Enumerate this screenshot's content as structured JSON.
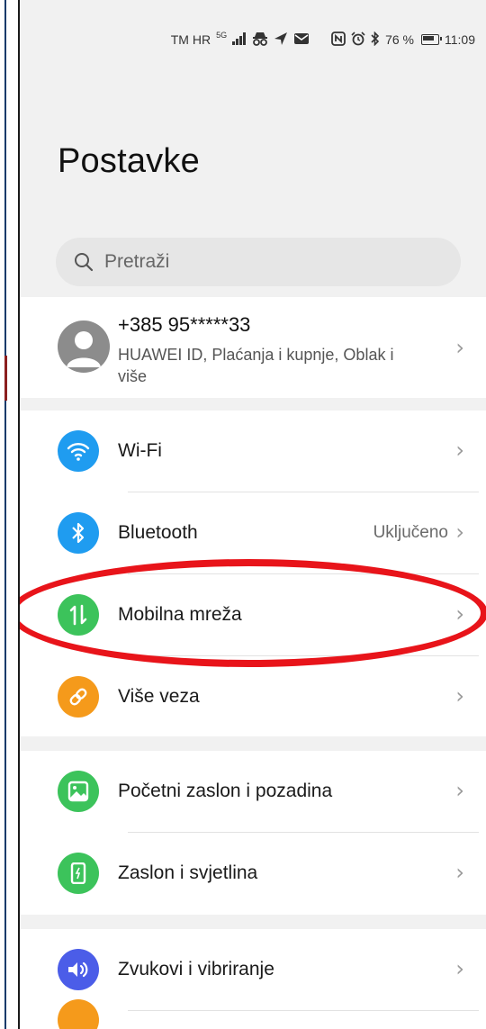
{
  "status_bar": {
    "carrier": "TM HR",
    "network": "5G",
    "battery_percent": "76 %",
    "time": "11:09"
  },
  "page": {
    "title": "Postavke"
  },
  "search": {
    "placeholder": "Pretraži"
  },
  "account": {
    "phone": "+385 95*****33",
    "subtitle": "HUAWEI ID, Plaćanja i kupnje, Oblak i više"
  },
  "groups": [
    {
      "items": [
        {
          "label": "Wi-Fi",
          "icon": "wifi-icon",
          "color": "#1f9cf0",
          "value": ""
        },
        {
          "label": "Bluetooth",
          "icon": "bluetooth-icon",
          "color": "#1f9cf0",
          "value": "Uključeno"
        },
        {
          "label": "Mobilna mreža",
          "icon": "mobile-data-icon",
          "color": "#3cc35b",
          "value": ""
        },
        {
          "label": "Više veza",
          "icon": "link-icon",
          "color": "#f59a1b",
          "value": ""
        }
      ]
    },
    {
      "items": [
        {
          "label": "Početni zaslon i pozadina",
          "icon": "wallpaper-icon",
          "color": "#3cc35b",
          "value": ""
        },
        {
          "label": "Zaslon i svjetlina",
          "icon": "display-brightness-icon",
          "color": "#3cc35b",
          "value": ""
        }
      ]
    },
    {
      "items": [
        {
          "label": "Zvukovi i vibriranje",
          "icon": "sound-icon",
          "color": "#4b5de8",
          "value": ""
        }
      ]
    }
  ],
  "annotation": {
    "highlight_color": "#e8141a"
  }
}
